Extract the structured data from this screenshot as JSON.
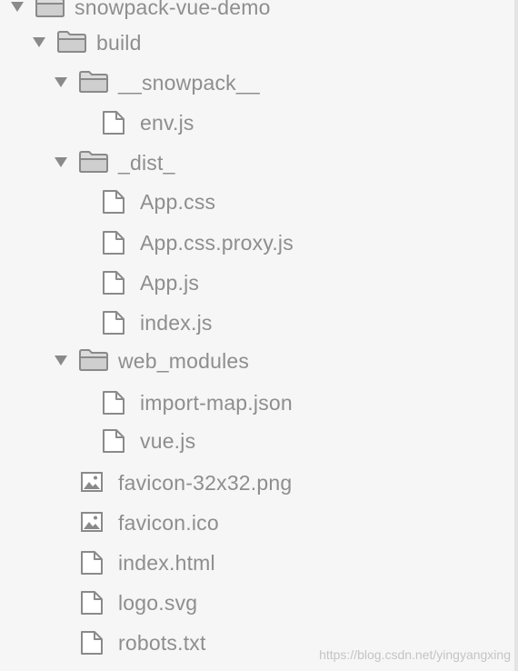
{
  "tree": {
    "root": {
      "label": "snowpack-vue-demo"
    },
    "build": {
      "label": "build"
    },
    "snowpack_folder": {
      "label": "__snowpack__"
    },
    "env_js": {
      "label": "env.js"
    },
    "dist_folder": {
      "label": "_dist_"
    },
    "app_css": {
      "label": "App.css"
    },
    "app_css_proxy": {
      "label": "App.css.proxy.js"
    },
    "app_js": {
      "label": "App.js"
    },
    "index_js": {
      "label": "index.js"
    },
    "web_modules": {
      "label": "web_modules"
    },
    "import_map": {
      "label": "import-map.json"
    },
    "vue_js": {
      "label": "vue.js"
    },
    "favicon_png": {
      "label": "favicon-32x32.png"
    },
    "favicon_ico": {
      "label": "favicon.ico"
    },
    "index_html": {
      "label": "index.html"
    },
    "logo_svg": {
      "label": "logo.svg"
    },
    "robots_txt": {
      "label": "robots.txt"
    }
  },
  "watermark": "https://blog.csdn.net/yingyangxing",
  "colors": {
    "background": "#f6f6f6",
    "text": "#8e8e8e",
    "icon": "#8a8a8a"
  }
}
